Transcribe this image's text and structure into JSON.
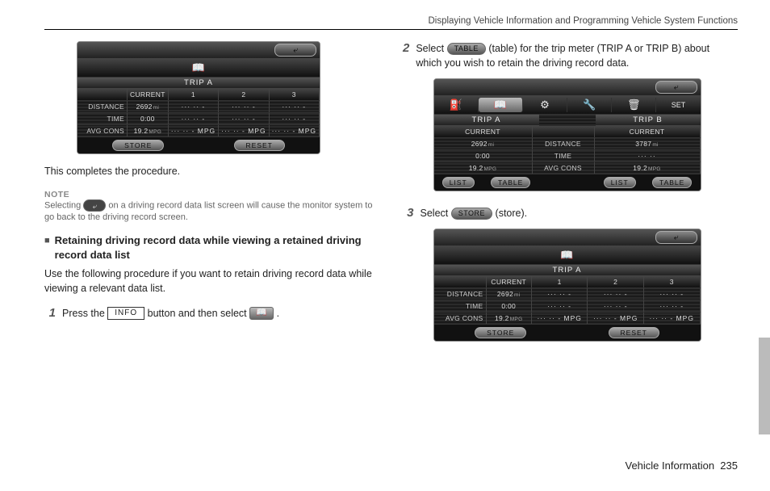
{
  "header": "Displaying Vehicle Information and Programming Vehicle System Functions",
  "footer": {
    "label": "Vehicle Information",
    "page": "235"
  },
  "left": {
    "completes": "This completes the procedure.",
    "note_head": "NOTE",
    "note_body_1": "Selecting ",
    "note_body_2": " on a driving record data list screen will cause the monitor system to go back to the driving record screen.",
    "section_title": "Retaining driving record data while viewing a retained driving record data list",
    "section_body": "Use the following procedure if you want to retain driving record data while viewing a relevant data list.",
    "step1_a": "Press the ",
    "step1_b": " button and then select ",
    "step1_end": " .",
    "info_label": "INFO"
  },
  "right": {
    "step2_a": "Select ",
    "step2_b": " (table) for the trip meter (TRIP A or TRIP B) about which you wish to retain the driving record data.",
    "table_label": "TABLE",
    "step3_a": "Select ",
    "step3_b": " (store).",
    "store_label": "STORE"
  },
  "screen_a": {
    "trip": "TRIP A",
    "cols": [
      "CURRENT",
      "1",
      "2",
      "3"
    ],
    "rows": [
      {
        "label": "DISTANCE",
        "cur": "2692",
        "unit": "mi",
        "v": [
          "··· ·· -",
          "··· ·· -",
          "··· ·· -"
        ]
      },
      {
        "label": "TIME",
        "cur": "0:00",
        "unit": "",
        "v": [
          "··· ·· -",
          "··· ·· -",
          "··· ·· -"
        ]
      },
      {
        "label": "AVG CONS",
        "cur": "19.2",
        "unit": "MPG",
        "v": [
          "··· ·· - MPG",
          "··· ·· - MPG",
          "··· ·· - MPG"
        ]
      }
    ],
    "store": "STORE",
    "reset": "RESET"
  },
  "screen_b": {
    "icons": [
      "⛽",
      "📖",
      "⚙",
      "🔧",
      "🗑",
      "SET"
    ],
    "trip_a": "TRIP A",
    "trip_b": "TRIP B",
    "rows_label": [
      "DISTANCE",
      "TIME",
      "AVG CONS"
    ],
    "a": {
      "sub": "CURRENT",
      "vals": [
        "2692",
        "0:00",
        "19.2"
      ],
      "units": [
        "mi",
        "",
        "MPG"
      ]
    },
    "b": {
      "sub": "CURRENT",
      "vals": [
        "3787",
        "··· ··",
        "19.2"
      ],
      "units": [
        "mi",
        "",
        "MPG"
      ]
    },
    "list": "LIST",
    "table": "TABLE"
  },
  "screen_c": {
    "trip": "TRIP A",
    "cols": [
      "CURRENT",
      "1",
      "2",
      "3"
    ],
    "rows": [
      {
        "label": "DISTANCE",
        "cur": "2692",
        "unit": "mi",
        "v": [
          "··· ·· -",
          "··· ·· -",
          "··· ·· -"
        ]
      },
      {
        "label": "TIME",
        "cur": "0:00",
        "unit": "",
        "v": [
          "··· ·· -",
          "··· ·· -",
          "··· ·· -"
        ]
      },
      {
        "label": "AVG CONS",
        "cur": "19.2",
        "unit": "MPG",
        "v": [
          "··· ·· - MPG",
          "··· ·· - MPG",
          "··· ·· - MPG"
        ]
      }
    ],
    "store": "STORE",
    "reset": "RESET"
  }
}
